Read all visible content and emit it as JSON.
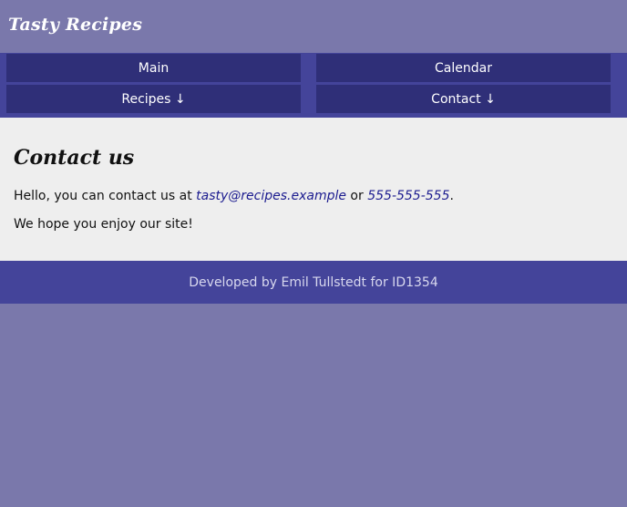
{
  "header": {
    "brand": "Tasty Recipes"
  },
  "nav": {
    "main": "Main",
    "calendar": "Calendar",
    "recipes": "Recipes ↓",
    "contact": "Contact ↓"
  },
  "content": {
    "title": "Contact us",
    "intro_prefix": "Hello, you can contact us at ",
    "email": "tasty@recipes.example",
    "connector": " or ",
    "phone": "555-555-555",
    "intro_suffix": ".",
    "closing": "We hope you enjoy our site!"
  },
  "footer": {
    "text": "Developed by Emil Tullstedt for ID1354"
  },
  "colors": {
    "page_background": "#7a78ab",
    "nav_background": "#44449a",
    "nav_button": "#2f2f78",
    "content_background": "#eeeeee",
    "link": "#1b1b8f"
  }
}
